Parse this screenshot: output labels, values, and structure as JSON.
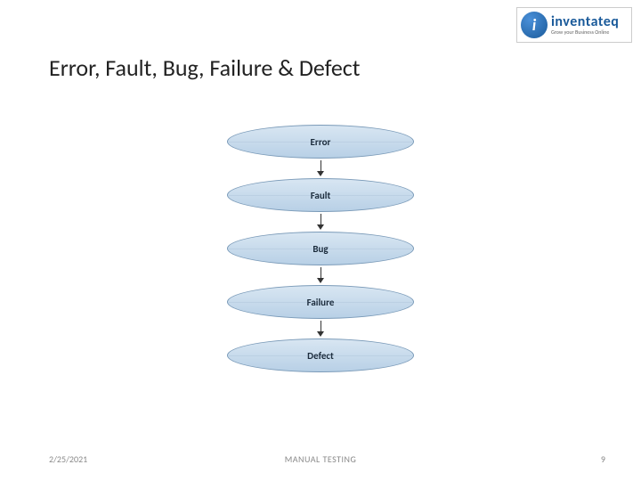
{
  "logo": {
    "letter": "i",
    "text": "inventateq",
    "tagline": "Grow your Business Online"
  },
  "title": "Error, Fault, Bug, Failure & Defect",
  "nodes": [
    "Error",
    "Fault",
    "Bug",
    "Failure",
    "Defect"
  ],
  "footer": {
    "date": "2/25/2021",
    "center": "MANUAL TESTING",
    "page": "9"
  }
}
